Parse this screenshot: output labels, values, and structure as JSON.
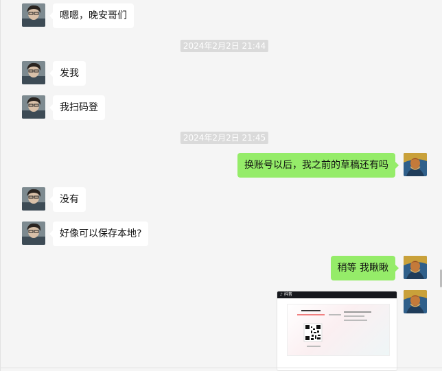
{
  "messages": [
    {
      "id": "m1",
      "dir": "in",
      "text": "嗯嗯，晚安哥们"
    },
    {
      "id": "ts1",
      "type": "time",
      "text": "2024年2月2日 21:44"
    },
    {
      "id": "m2",
      "dir": "in",
      "text": "发我"
    },
    {
      "id": "m3",
      "dir": "in",
      "text": "我扫码登"
    },
    {
      "id": "ts2",
      "type": "time",
      "text": "2024年2月2日 21:45"
    },
    {
      "id": "m4",
      "dir": "out",
      "text": "换账号以后，我之前的草稿还有吗"
    },
    {
      "id": "m5",
      "dir": "in",
      "text": "没有"
    },
    {
      "id": "m6",
      "dir": "in",
      "text": "好像可以保存本地?"
    },
    {
      "id": "m7",
      "dir": "out",
      "text": "稍等 我瞅瞅"
    },
    {
      "id": "m8",
      "dir": "out",
      "type": "image"
    }
  ],
  "image_card": {
    "header_label": "抖音"
  },
  "colors": {
    "background": "#f5f5f5",
    "bubble_in": "#ffffff",
    "bubble_out": "#95ec69",
    "timestamp_bg": "#dadada"
  },
  "icons": {
    "incoming_avatar": "friend-avatar",
    "outgoing_avatar": "self-avatar"
  }
}
